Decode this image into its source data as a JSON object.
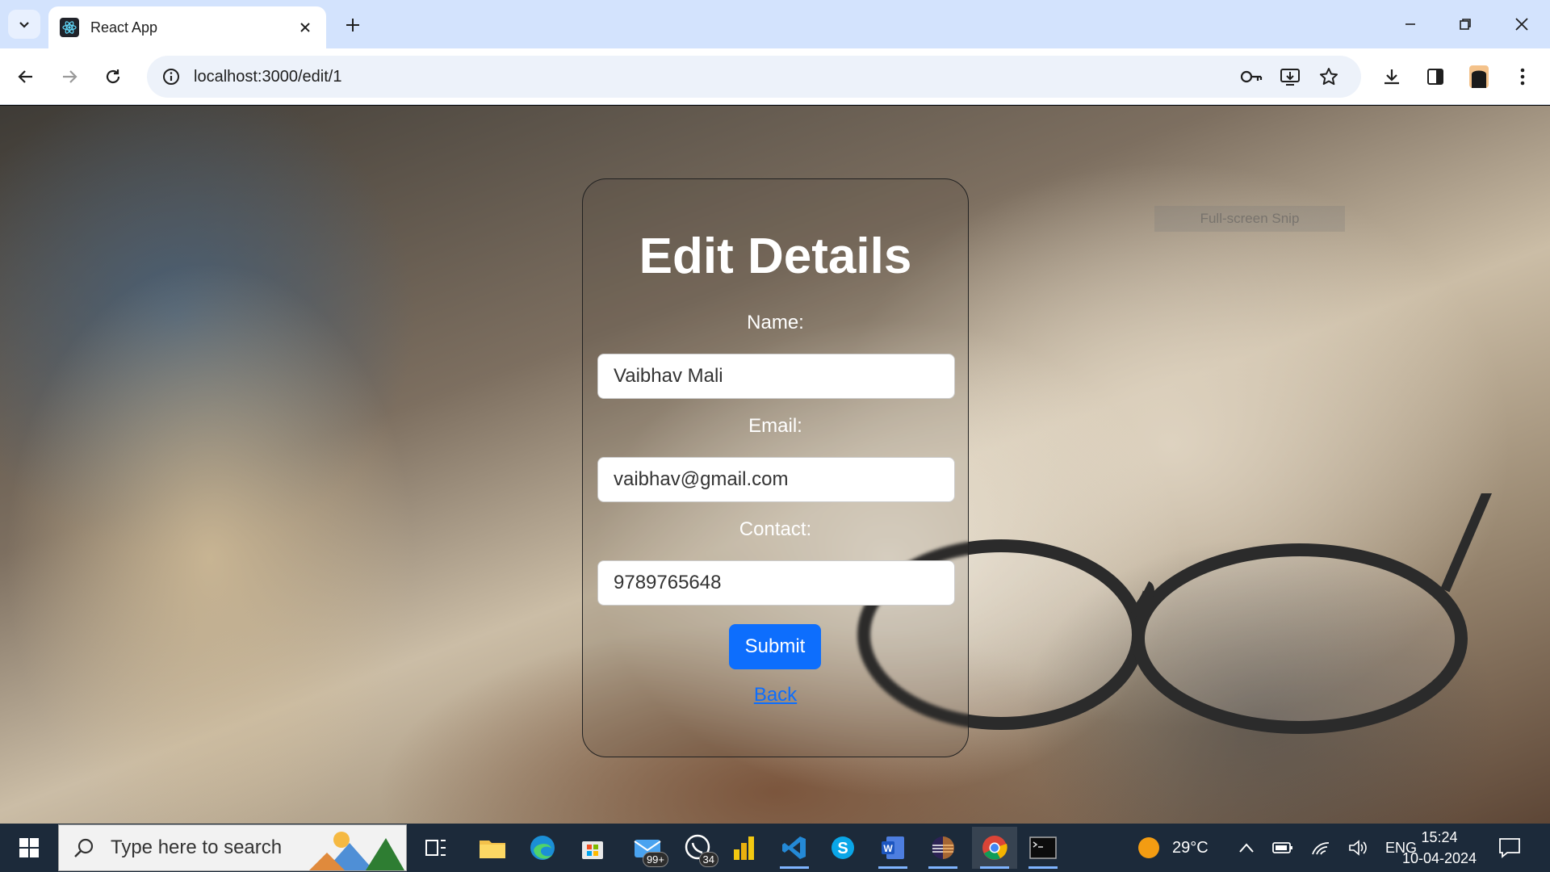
{
  "browser": {
    "tab_title": "React App",
    "url": "localhost:3000/edit/1"
  },
  "page": {
    "title": "Edit Details",
    "name_label": "Name:",
    "name_value": "Vaibhav Mali",
    "email_label": "Email:",
    "email_value": "vaibhav@gmail.com",
    "contact_label": "Contact:",
    "contact_value": "9789765648",
    "submit_label": "Submit",
    "back_label": "Back",
    "snip_hint": "Full-screen Snip"
  },
  "taskbar": {
    "search_placeholder": "Type here to search",
    "mail_badge": "99+",
    "whatsapp_badge": "34",
    "weather": "29°C",
    "language": "ENG",
    "time": "15:24",
    "date": "10-04-2024"
  },
  "colors": {
    "accent": "#0d6efd",
    "tabstrip": "#d3e3fd",
    "taskbar": "#1c2a3a"
  }
}
